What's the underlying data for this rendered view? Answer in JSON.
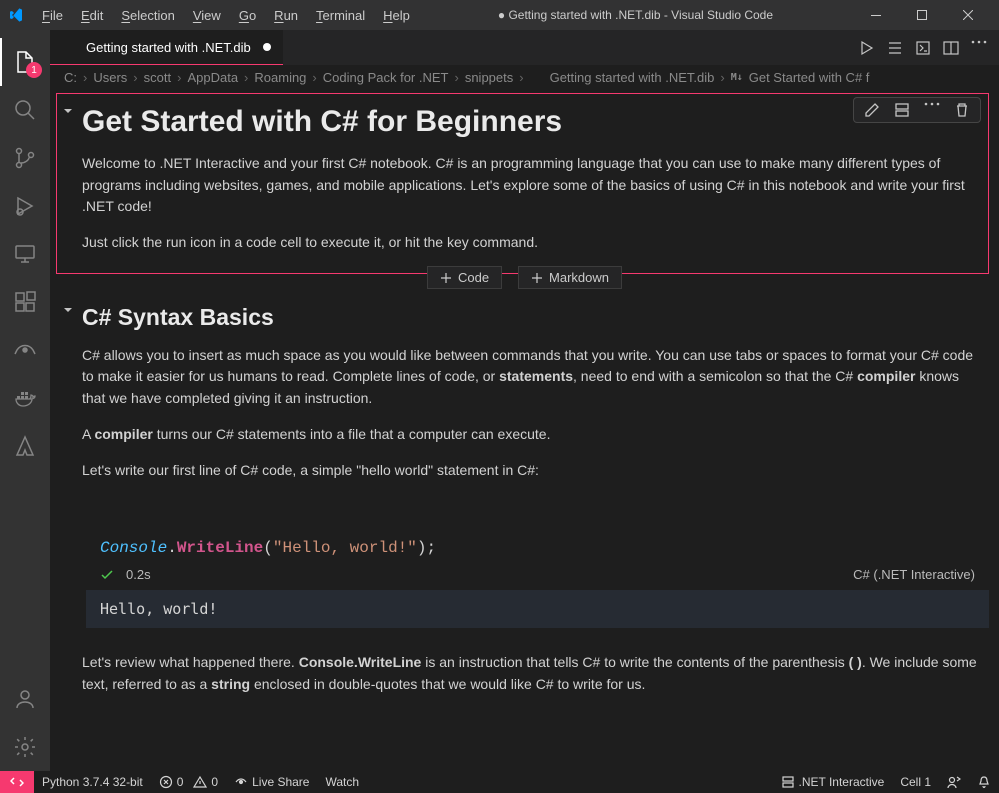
{
  "menu": {
    "file": "File",
    "edit": "Edit",
    "selection": "Selection",
    "view": "View",
    "go": "Go",
    "run": "Run",
    "terminal": "Terminal",
    "help": "Help"
  },
  "window_title": "Getting started with .NET.dib - Visual Studio Code",
  "tab": {
    "label": "Getting started with .NET.dib"
  },
  "breadcrumbs": [
    "C:",
    "Users",
    "scott",
    "AppData",
    "Roaming",
    "Coding Pack for .NET",
    "snippets",
    "Getting started with .NET.dib",
    "Get Started with C# f"
  ],
  "cell1": {
    "title": "Get Started with C# for Beginners",
    "p1": "Welcome to .NET Interactive and your first C# notebook. C# is an programming language that you can use to make many different types of programs including websites, games, and mobile applications. Let's explore some of the basics of using C# in this notebook and write your first .NET code!",
    "p2": "Just click the run icon in a code cell to execute it, or hit the key command."
  },
  "addcell": {
    "code": "Code",
    "md": "Markdown"
  },
  "cell2": {
    "title": "C# Syntax Basics",
    "p1a": "C# allows you to insert as much space as you would like between commands that you write. You can use tabs or spaces to format your C# code to make it easier for us humans to read. Complete lines of code, or ",
    "p1b": "statements",
    "p1c": ", need to end with a semicolon so that the C# ",
    "p1d": "compiler",
    "p1e": " knows that we have completed giving it an instruction.",
    "p2a": "A ",
    "p2b": "compiler",
    "p2c": " turns our C# statements into a file that a computer can execute.",
    "p3": "Let's write our first line of C# code, a simple \"hello world\" statement in C#:"
  },
  "code": {
    "type": "Console",
    "method": "WriteLine",
    "string": "\"Hello, world!\"",
    "time": "0.2s",
    "kernel": "C# (.NET Interactive)",
    "output": "Hello, world!"
  },
  "cell3": {
    "a": "Let's review what happened there. ",
    "b": "Console.WriteLine",
    "c": " is an instruction that tells C# to write the contents of the parenthesis ",
    "d": "( )",
    "e": ". We include some text, referred to as a ",
    "f": "string",
    "g": " enclosed in double-quotes that we would like C# to write for us."
  },
  "status": {
    "python": "Python 3.7.4 32-bit",
    "errors": "0",
    "warnings": "0",
    "liveshare": "Live Share",
    "watch": "Watch",
    "kernel": ".NET Interactive",
    "cell": "Cell 1"
  },
  "activity_badge": "1"
}
